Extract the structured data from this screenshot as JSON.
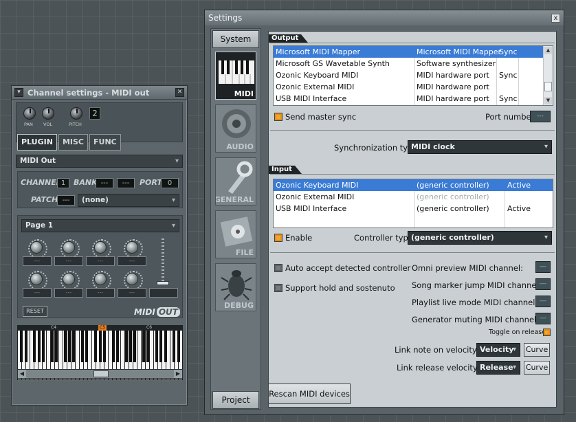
{
  "channel": {
    "title": "Channel settings - MIDI out",
    "menu_glyph": "▾",
    "close_glyph": "✕",
    "knob_labels": [
      "PAN",
      "VOL",
      "PITCH"
    ],
    "lcd_value": "2",
    "tabs": [
      "PLUGIN",
      "MISC",
      "FUNC"
    ],
    "plugin_name": "MIDI Out",
    "channel_label": "CHANNEL",
    "channel_value": "1",
    "bank_label": "BANK",
    "bank_value1": "---",
    "bank_value2": "---",
    "port_label": "PORT",
    "port_value": "0",
    "patch_label": "PATCH",
    "patch_value": "---",
    "patch_select": "(none)",
    "page_select": "Page 1",
    "slot_text": "---",
    "reset_label": "RESET",
    "logo_text": "MIDI",
    "logo_badge": "OUT",
    "piano_markers": [
      "C4",
      "C5",
      "C6"
    ]
  },
  "settings": {
    "title": "Settings",
    "close_glyph": "x",
    "side_top_button": "System",
    "side_bottom_button": "Project",
    "categories": [
      {
        "label": "MIDI",
        "icon": "piano-keys-icon"
      },
      {
        "label": "AUDIO",
        "icon": "speaker-icon"
      },
      {
        "label": "GENERAL",
        "icon": "wrench-icon"
      },
      {
        "label": "FILE",
        "icon": "disk-icon"
      },
      {
        "label": "DEBUG",
        "icon": "bug-icon"
      }
    ],
    "output": {
      "header": "Output",
      "rows": [
        {
          "name": "Microsoft MIDI Mapper",
          "type": "Microsoft MIDI Mapper",
          "status": "Sync",
          "selected": true
        },
        {
          "name": "Microsoft GS Wavetable Synth",
          "type": "Software synthesizer",
          "status": ""
        },
        {
          "name": "Ozonic Keyboard MIDI",
          "type": "MIDI hardware port",
          "status": "Sync"
        },
        {
          "name": "Ozonic External MIDI",
          "type": "MIDI hardware port",
          "status": ""
        },
        {
          "name": "USB MIDI Interface",
          "type": "MIDI hardware port",
          "status": "Sync"
        }
      ],
      "send_master_sync": "Send master sync",
      "port_number_label": "Port number:",
      "port_number_value": "---",
      "sync_type_label": "Synchronization type:",
      "sync_type_value": "MIDI clock"
    },
    "input": {
      "header": "Input",
      "rows": [
        {
          "name": "Ozonic Keyboard MIDI",
          "type": "(generic controller)",
          "status": "Active",
          "selected": true
        },
        {
          "name": "Ozonic External MIDI",
          "type": "(generic controller)",
          "status": "",
          "dim": true
        },
        {
          "name": "USB MIDI Interface",
          "type": "(generic controller)",
          "status": "Active"
        }
      ],
      "enable_label": "Enable",
      "controller_type_label": "Controller type:",
      "controller_type_value": "(generic controller)"
    },
    "options": {
      "auto_accept": "Auto accept detected controller",
      "support_hold": "Support hold and sostenuto",
      "omni_preview": "Omni preview MIDI channel:",
      "song_marker": "Song marker jump MIDI channel:",
      "playlist_live": "Playlist live mode MIDI channel:",
      "generator_muting": "Generator muting MIDI channel:",
      "spin_value": "---",
      "toggle_on_release": "Toggle on release",
      "link_note_label": "Link note on velocity to:",
      "link_note_value": "Velocity",
      "link_release_label": "Link release velocity to:",
      "link_release_value": "Release",
      "curve_label": "Curve"
    },
    "rescan_label": "Rescan MIDI devices"
  }
}
